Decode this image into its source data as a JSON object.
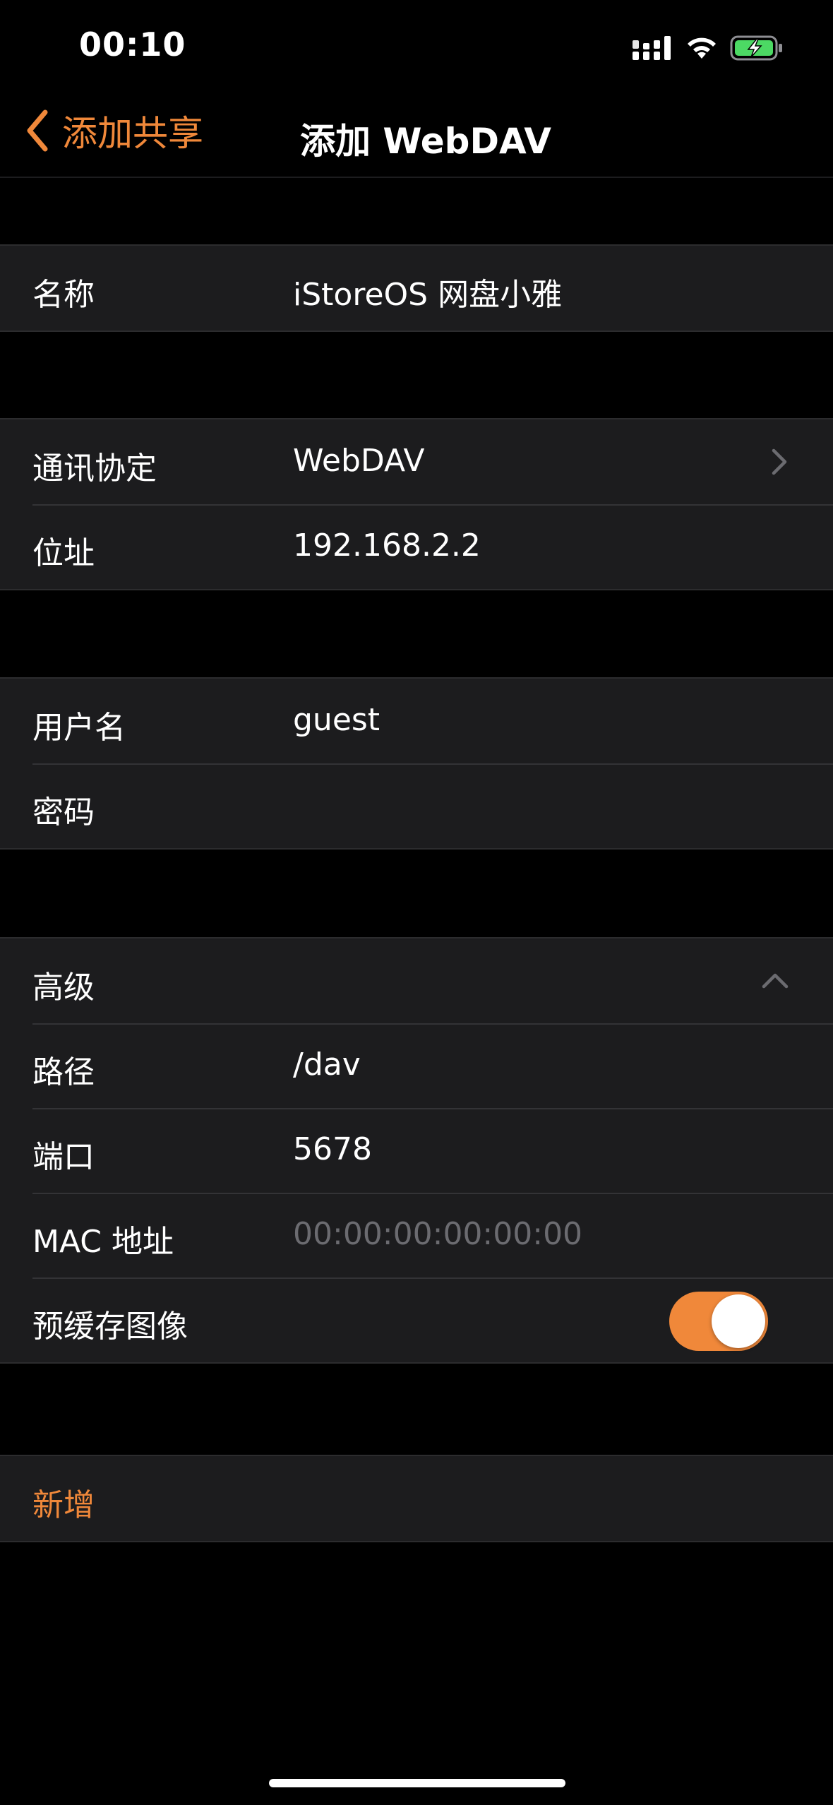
{
  "status_bar": {
    "time": "00:10",
    "icons": [
      "signal-icon",
      "wifi-icon",
      "battery-charging-icon"
    ]
  },
  "nav": {
    "back_label": "添加共享",
    "title": "添加 WebDAV"
  },
  "colors": {
    "accent": "#f0883a",
    "background": "#000000",
    "cell_background": "#1c1c1e",
    "placeholder": "#6b6b70"
  },
  "basic": {
    "name_label": "名称",
    "name_value": "iStoreOS 网盘小雅"
  },
  "connection": {
    "protocol_label": "通讯协定",
    "protocol_value": "WebDAV",
    "address_label": "位址",
    "address_value": "192.168.2.2"
  },
  "credentials": {
    "username_label": "用户名",
    "username_value": "guest",
    "password_label": "密码"
  },
  "advanced": {
    "header_label": "高级",
    "path_label": "路径",
    "path_value": "/dav",
    "port_label": "端口",
    "port_value": "5678",
    "mac_label": "MAC 地址",
    "mac_placeholder": "00:00:00:00:00:00",
    "cache_label": "预缓存图像",
    "cache_enabled": true
  },
  "actions": {
    "add_label": "新增"
  }
}
